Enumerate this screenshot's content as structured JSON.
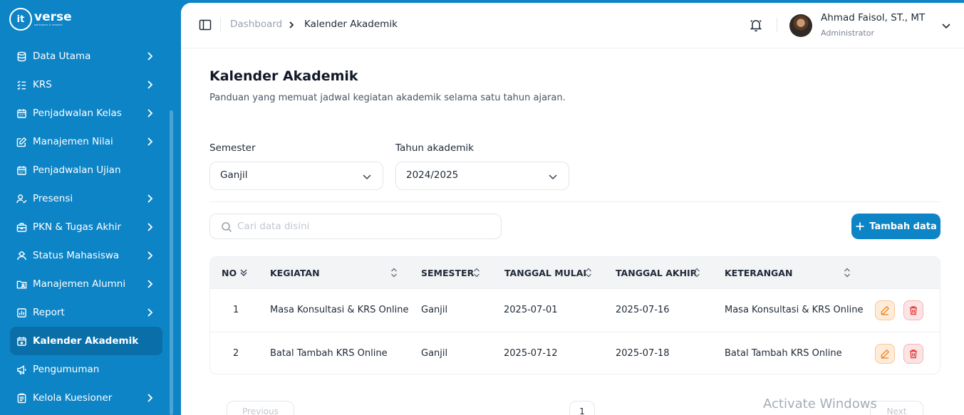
{
  "brand": {
    "mark": "it",
    "name": "verse",
    "tagline": "workspace & network"
  },
  "sidebar": {
    "items": [
      {
        "label": "Data Utama",
        "icon": "database-icon",
        "has_children": true
      },
      {
        "label": "KRS",
        "icon": "list-check-icon",
        "has_children": true
      },
      {
        "label": "Penjadwalan Kelas",
        "icon": "calendar-icon",
        "has_children": true
      },
      {
        "label": "Manajemen Nilai",
        "icon": "edit-icon",
        "has_children": true
      },
      {
        "label": "Penjadwalan Ujian",
        "icon": "calendar-icon",
        "has_children": false
      },
      {
        "label": "Presensi",
        "icon": "user-check-icon",
        "has_children": true
      },
      {
        "label": "PKN & Tugas Akhir",
        "icon": "briefcase-icon",
        "has_children": true
      },
      {
        "label": "Status Mahasiswa",
        "icon": "user-status-icon",
        "has_children": true
      },
      {
        "label": "Manajemen Alumni",
        "icon": "folder-user-icon",
        "has_children": true
      },
      {
        "label": "Report",
        "icon": "report-icon",
        "has_children": true
      },
      {
        "label": "Kalender Akademik",
        "icon": "calendar-star-icon",
        "has_children": false,
        "active": true
      },
      {
        "label": "Pengumuman",
        "icon": "megaphone-icon",
        "has_children": false
      },
      {
        "label": "Kelola Kuesioner",
        "icon": "clipboard-icon",
        "has_children": true
      }
    ]
  },
  "header": {
    "breadcrumb": [
      "Dashboard",
      "Kalender Akademik"
    ],
    "user": {
      "name": "Ahmad Faisol, ST., MT",
      "role": "Administrator"
    }
  },
  "page": {
    "title": "Kalender Akademik",
    "description": "Panduan yang memuat jadwal kegiatan akademik selama satu tahun ajaran."
  },
  "filters": {
    "semester": {
      "label": "Semester",
      "value": "Ganjil"
    },
    "tahun": {
      "label": "Tahun akademik",
      "value": "2024/2025"
    }
  },
  "search": {
    "placeholder": "Cari data disini"
  },
  "add_button": {
    "label": "Tambah data"
  },
  "table": {
    "columns": [
      "NO",
      "KEGIATAN",
      "SEMESTER",
      "TANGGAL MULAI",
      "TANGGAL AKHIR",
      "KETERANGAN"
    ],
    "rows": [
      {
        "no": "1",
        "kegiatan": "Masa Konsultasi & KRS Online",
        "semester": "Ganjil",
        "mulai": "2025-07-01",
        "akhir": "2025-07-16",
        "keterangan": "Masa Konsultasi & KRS Online"
      },
      {
        "no": "2",
        "kegiatan": "Batal Tambah KRS Online",
        "semester": "Ganjil",
        "mulai": "2025-07-12",
        "akhir": "2025-07-18",
        "keterangan": "Batal Tambah KRS Online"
      }
    ]
  },
  "pagination": {
    "previous": "Previous",
    "page": "1",
    "next": "Next"
  },
  "watermark": "Activate Windows",
  "colors": {
    "primary": "#0d84c6",
    "edit": "#f59e4b",
    "delete": "#e53e3e"
  }
}
